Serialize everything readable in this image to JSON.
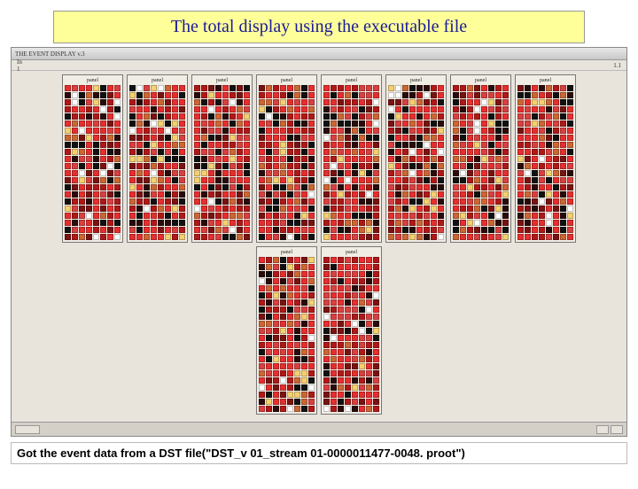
{
  "title": "The total display using the executable file",
  "window": {
    "title": "THE EVENT DISPLAY v.3",
    "menu_left": "In 1",
    "menu_right": "1.1"
  },
  "panels_row1": [
    {
      "label": "panel"
    },
    {
      "label": "panel"
    },
    {
      "label": "panel"
    },
    {
      "label": "panel"
    },
    {
      "label": "panel"
    },
    {
      "label": "panel"
    },
    {
      "label": "panel"
    },
    {
      "label": "panel"
    }
  ],
  "panels_row2": [
    {
      "label": "panel"
    },
    {
      "label": "panel"
    }
  ],
  "grid": {
    "cols": 8,
    "rows": 22
  },
  "footer": "Got the event data from a DST file(\"DST_v 01_stream 01-0000011477-0048. proot\")"
}
